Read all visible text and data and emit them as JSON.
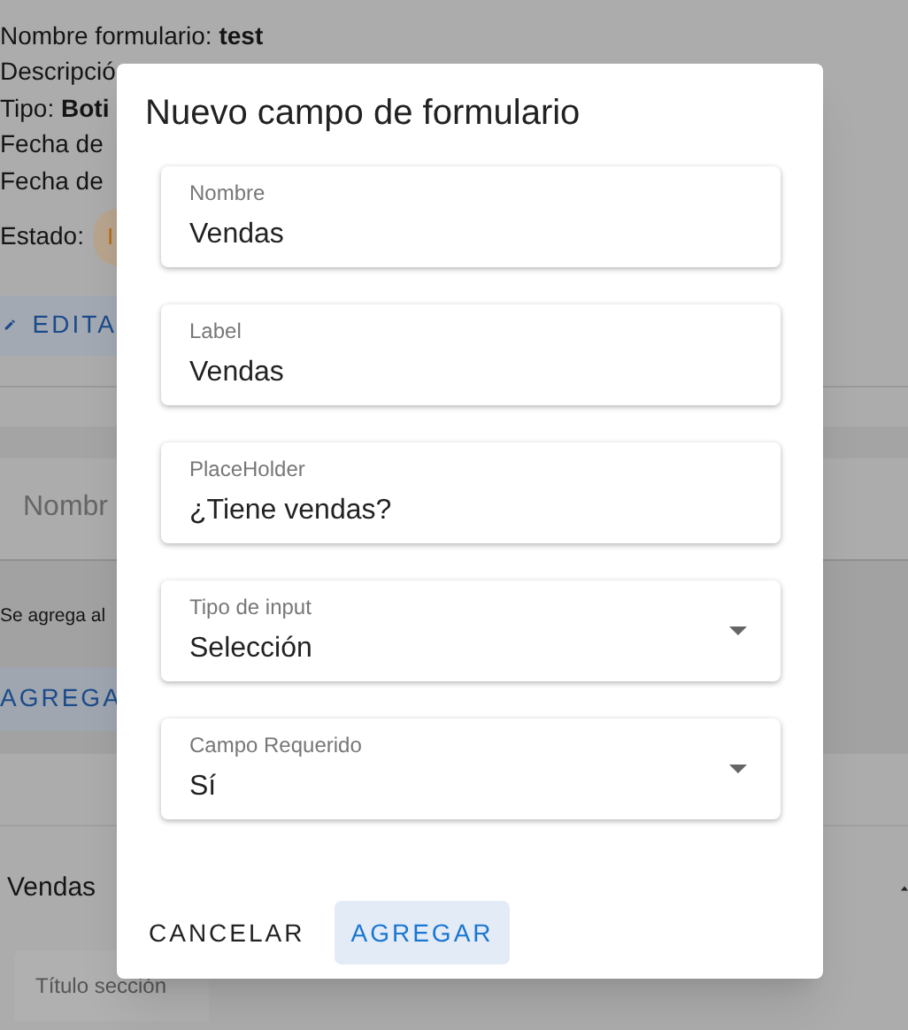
{
  "background": {
    "info_lines": [
      "Nombre formulario: **test**",
      "Descripció",
      "Tipo: **Boti**",
      "Fecha de",
      "Fecha de"
    ],
    "status": {
      "label": "Estado:",
      "chip": "I"
    },
    "edit_button": {
      "label": "EDITA"
    },
    "name_field": {
      "placeholder": "Nombr"
    },
    "note": "Se agrega al",
    "add_button": {
      "label": "AGREGA"
    },
    "section": {
      "title": "Vendas",
      "expanded": true
    },
    "section_title_field": {
      "label": "Título sección"
    }
  },
  "dialog": {
    "title": "Nuevo campo de formulario",
    "fields": [
      {
        "kind": "text",
        "label": "Nombre",
        "value": "Vendas"
      },
      {
        "kind": "text",
        "label": "Label",
        "value": "Vendas"
      },
      {
        "kind": "text",
        "label": "PlaceHolder",
        "value": "¿Tiene vendas?"
      },
      {
        "kind": "select",
        "label": "Tipo de input",
        "value": "Selección"
      },
      {
        "kind": "select",
        "label": "Campo Requerido",
        "value": "Sí"
      }
    ],
    "buttons": [
      {
        "label": "CANCELAR",
        "kind": "text"
      },
      {
        "label": "AGREGAR",
        "kind": "primary"
      }
    ]
  }
}
